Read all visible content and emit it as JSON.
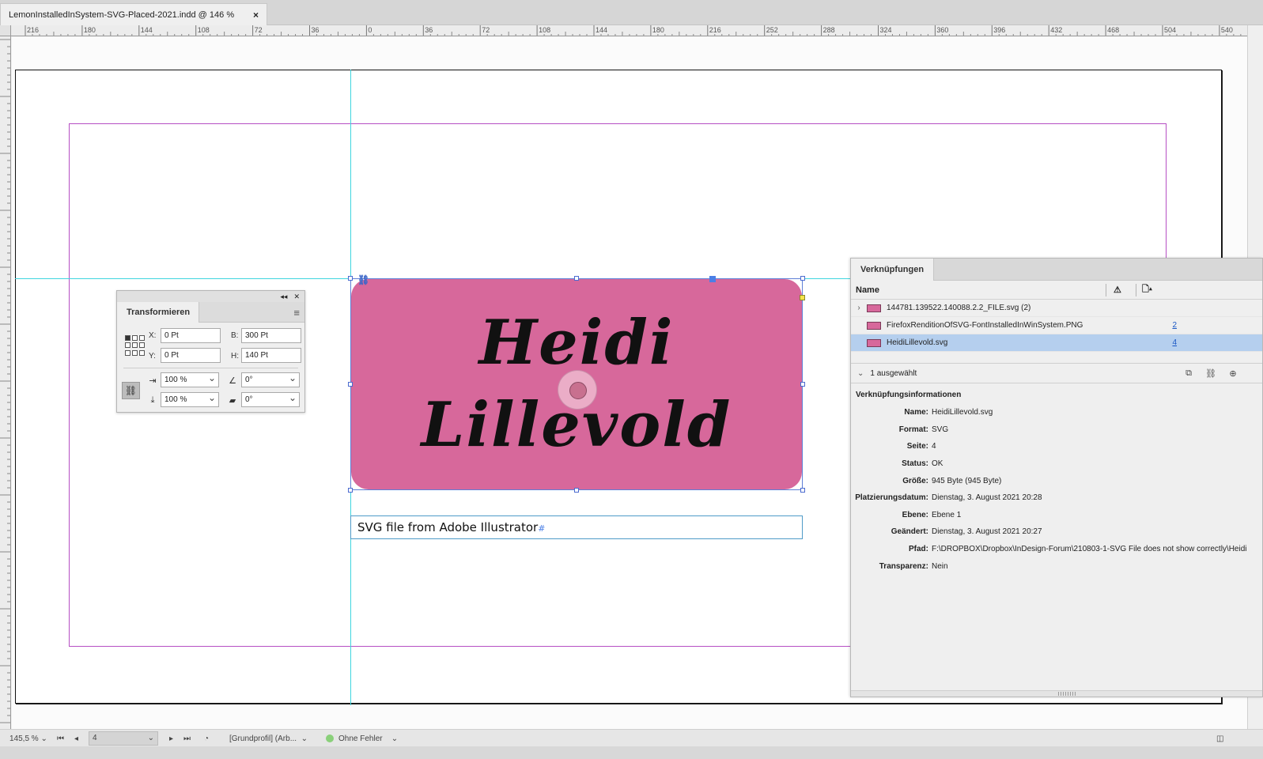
{
  "document": {
    "tab_title": "LemonInstalledInSystem-SVG-Placed-2021.indd @ 146 %",
    "tab_close": "×"
  },
  "ruler_h": [
    "216",
    "180",
    "144",
    "108",
    "72",
    "36",
    "0",
    "36",
    "72",
    "108",
    "144",
    "180",
    "216",
    "252",
    "288",
    "324",
    "360",
    "396",
    "432",
    "468",
    "504",
    "540"
  ],
  "canvas": {
    "graphic_line1": "Heidi",
    "graphic_line2": "Lillevold",
    "graphic_color": "#d7689b",
    "text_frame": "SVG file from Adobe Illustrator",
    "text_frame_mark": "#"
  },
  "transform": {
    "title": "Transformieren",
    "x_label": "X:",
    "x_value": "0 Pt",
    "y_label": "Y:",
    "y_value": "0 Pt",
    "w_label": "B:",
    "w_value": "300 Pt",
    "h_label": "H:",
    "h_value": "140 Pt",
    "scale_x": "100 %",
    "scale_y": "100 %",
    "rotate": "0°",
    "shear": "0°"
  },
  "links": {
    "title": "Verknüpfungen",
    "col_name": "Name",
    "rows": [
      {
        "name": "144781.139522.140088.2.2_FILE.svg (2)",
        "page": ""
      },
      {
        "name": "FirefoxRenditionOfSVG-FontInstalledInWinSystem.PNG",
        "page": "2"
      },
      {
        "name": "HeidiLillevold.svg",
        "page": "4"
      }
    ],
    "selected_count": "1 ausgewählt",
    "info_title": "Verknüpfungsinformationen",
    "info": [
      {
        "k": "Name:",
        "v": "HeidiLillevold.svg"
      },
      {
        "k": "Format:",
        "v": "SVG"
      },
      {
        "k": "Seite:",
        "v": "4"
      },
      {
        "k": "Status:",
        "v": "OK"
      },
      {
        "k": "Größe:",
        "v": "945 Byte (945 Byte)"
      },
      {
        "k": "Platzierungsdatum:",
        "v": "Dienstag, 3. August 2021 20:28"
      },
      {
        "k": "Ebene:",
        "v": "Ebene 1"
      },
      {
        "k": "Geändert:",
        "v": "Dienstag, 3. August 2021 20:27"
      },
      {
        "k": "Pfad:",
        "v": "F:\\DROPBOX\\Dropbox\\InDesign-Forum\\210803-1-SVG File does  not show correctly\\Heidi"
      },
      {
        "k": "Transparenz:",
        "v": "Nein"
      }
    ]
  },
  "status": {
    "zoom": "145,5 %",
    "page": "4",
    "profile": "[Grundprofil] (Arb...",
    "preflight": "Ohne Fehler"
  }
}
